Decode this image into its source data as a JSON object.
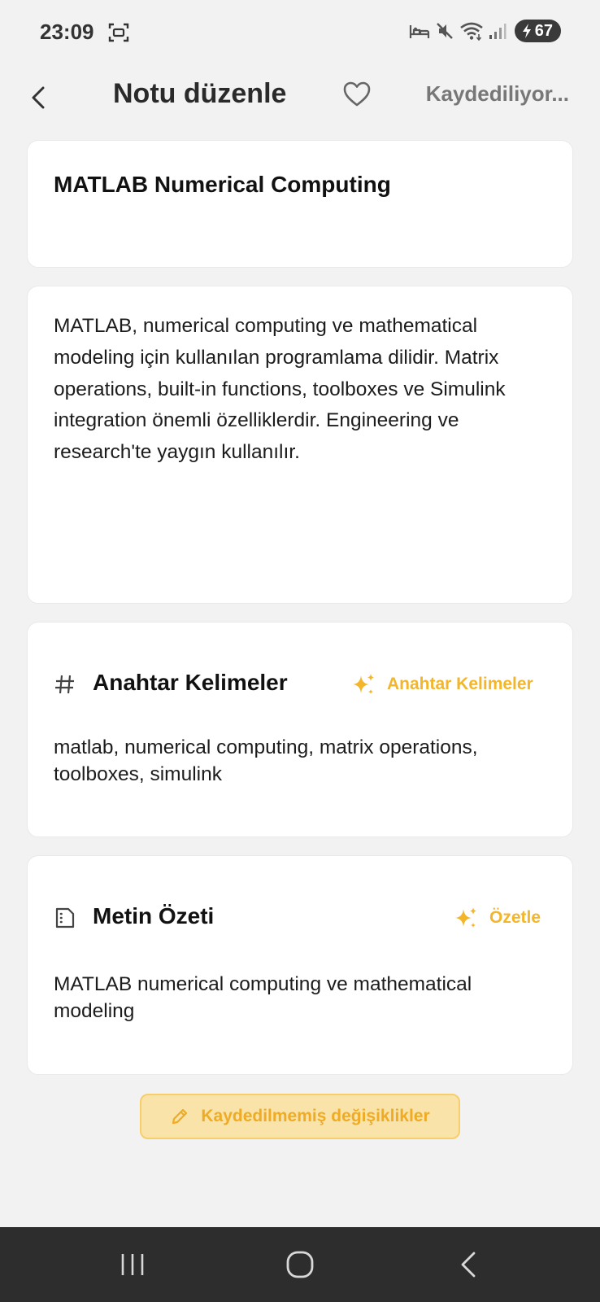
{
  "status_bar": {
    "time": "23:09",
    "battery": "67",
    "icons": [
      "screenshot-icon",
      "sleep-icon",
      "mute-icon",
      "wifi-icon",
      "signal-icon",
      "charging-icon"
    ]
  },
  "header": {
    "title": "Notu düzenle",
    "save_status": "Kaydediliyor...",
    "icons": [
      "back-arrow-icon",
      "heart-icon"
    ]
  },
  "note": {
    "title": "MATLAB Numerical Computing",
    "content": "MATLAB, numerical computing ve mathematical modeling için kullanılan programlama dilidir. Matrix operations, built-in functions, toolboxes ve Simulink integration önemli özelliklerdir. Engineering ve research'te yaygın kullanılır."
  },
  "keywords": {
    "title": "Anahtar Kelimeler",
    "action_label": "Anahtar Kelimeler",
    "text": "matlab, numerical computing, matrix operations, toolboxes, simulink",
    "icons": [
      "hash-icon",
      "sparkle-icon"
    ]
  },
  "summary": {
    "title": "Metin Özeti",
    "action_label": "Özetle",
    "text": "MATLAB numerical computing ve mathematical modeling",
    "icons": [
      "document-icon",
      "sparkle-icon"
    ]
  },
  "unsaved": {
    "label": "Kaydedilmemiş değişiklikler",
    "icon": "pencil-icon"
  },
  "colors": {
    "background": "#f2f2f2",
    "card": "#ffffff",
    "accent": "#f3b52a",
    "unsaved_bg": "#fae3a8",
    "nav_bar": "#2d2d2d"
  },
  "nav_bar": {
    "icons": [
      "recent-apps-icon",
      "home-icon",
      "back-icon"
    ]
  }
}
